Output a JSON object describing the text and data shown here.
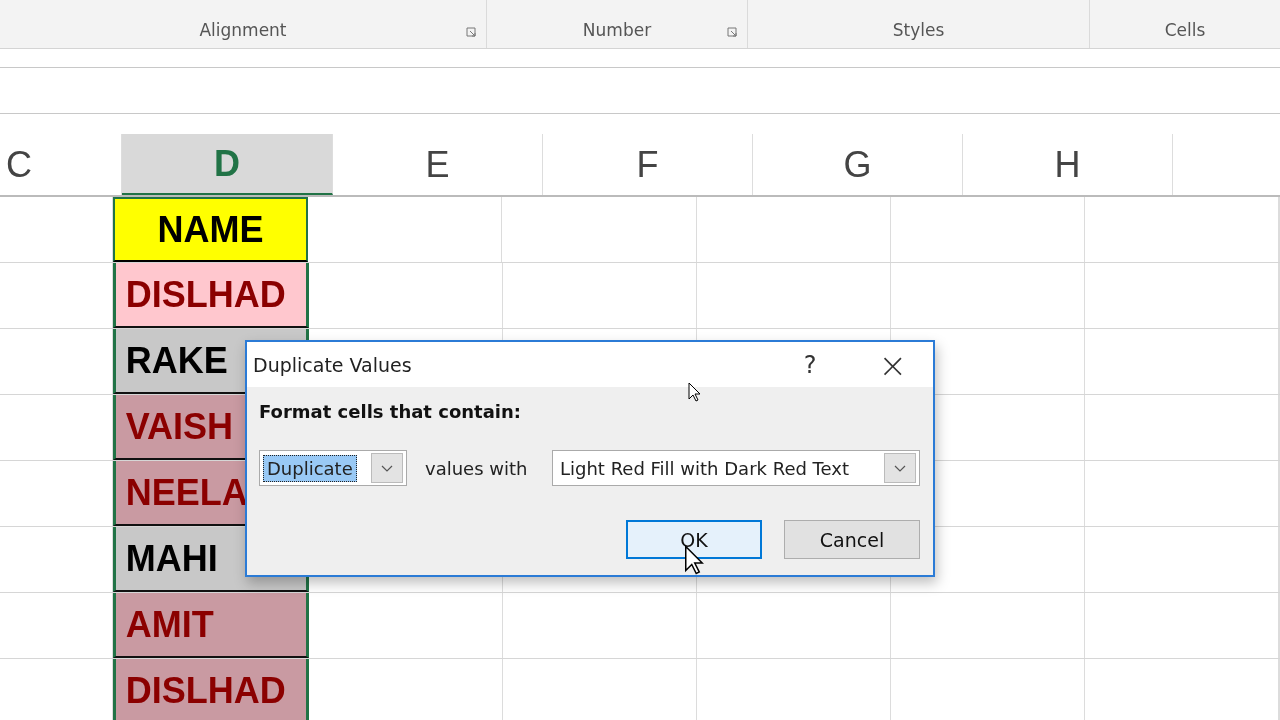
{
  "ribbon": {
    "groups": [
      {
        "label": "Alignment",
        "launcher": true
      },
      {
        "label": "Number",
        "launcher": true
      },
      {
        "label": "Styles",
        "launcher": false
      },
      {
        "label": "Cells",
        "launcher": false
      }
    ]
  },
  "sheet": {
    "columns": [
      {
        "label": "C",
        "selected": false
      },
      {
        "label": "D",
        "selected": true
      },
      {
        "label": "E",
        "selected": false
      },
      {
        "label": "F",
        "selected": false
      },
      {
        "label": "G",
        "selected": false
      },
      {
        "label": "H",
        "selected": false
      }
    ],
    "header_cell": "NAME",
    "rows": [
      {
        "text": "DISLHAD",
        "duplicate": true,
        "active": true
      },
      {
        "text": "RAKE",
        "duplicate": false,
        "active": false
      },
      {
        "text": "VAISH",
        "duplicate": true,
        "active": false
      },
      {
        "text": "NEELA",
        "duplicate": true,
        "active": false
      },
      {
        "text": "MAHI",
        "duplicate": false,
        "active": false
      },
      {
        "text": "AMIT",
        "duplicate": true,
        "active": false
      },
      {
        "text": "DISLHAD",
        "duplicate": true,
        "active": false
      }
    ]
  },
  "dialog": {
    "title": "Duplicate Values",
    "help": "?",
    "close": "×",
    "prompt": "Format cells that contain:",
    "type_value": "Duplicate",
    "middle_label": "values with",
    "format_value": "Light Red Fill with Dark Red Text",
    "buttons": [
      {
        "label": "OK",
        "default": true
      },
      {
        "label": "Cancel",
        "default": false
      }
    ]
  }
}
